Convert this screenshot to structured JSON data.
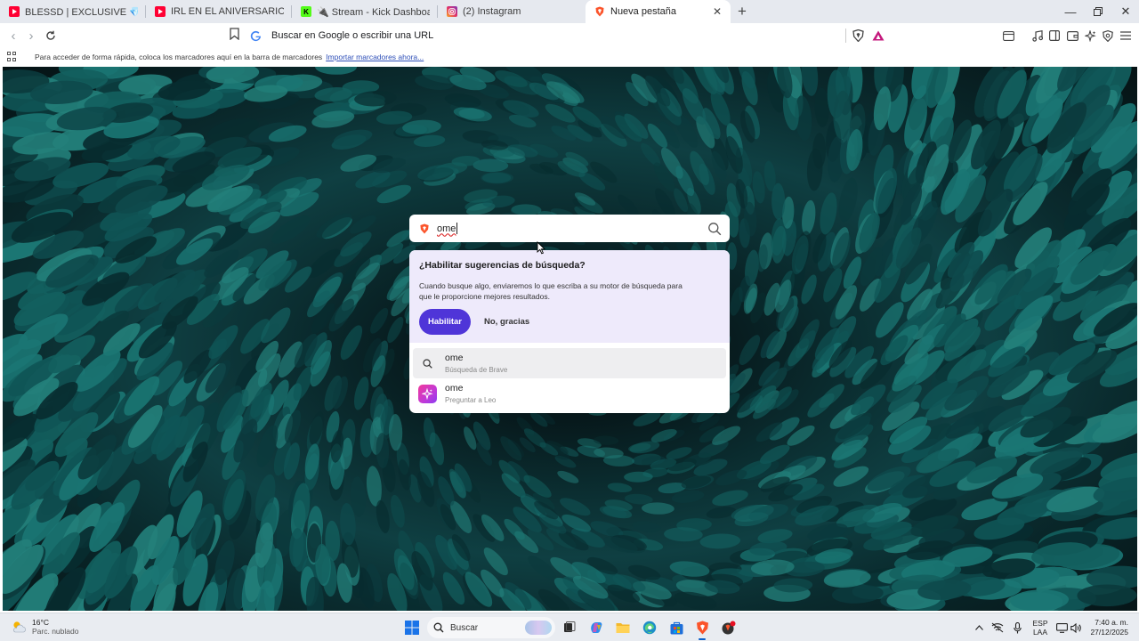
{
  "tabs": [
    {
      "title": "BLESSD | EXCLUSIVE 💎 - YouTube",
      "favicon": "youtube-icon",
      "color": "#ff0033",
      "active": false
    },
    {
      "title": "IRL EN EL ANIVERSARIO DE DULCINE",
      "favicon": "youtube-icon",
      "color": "#ff0033",
      "active": false
    },
    {
      "title": "🔌 Stream - Kick Dashboard",
      "favicon": "kick-icon",
      "color": "#1b1b1b",
      "active": false
    },
    {
      "title": "(2) Instagram",
      "favicon": "instagram-icon",
      "color": "#d6249f",
      "active": false
    },
    {
      "title": "Nueva pestaña",
      "favicon": "brave-icon",
      "color": "#fb542b",
      "active": true
    }
  ],
  "omnibox": {
    "placeholder": "Buscar en Google o escribir una URL"
  },
  "bookmarks": {
    "hint": "Para acceder de forma rápida, coloca los marcadores aquí en la barra de marcadores",
    "import_link": "Importar marcadores ahora..."
  },
  "search": {
    "query": "ome"
  },
  "suggestions_prompt": {
    "title": "¿Habilitar sugerencias de búsqueda?",
    "description": "Cuando busque algo, enviaremos lo que escriba a su motor de búsqueda para que le proporcione mejores resultados.",
    "enable_label": "Habilitar",
    "decline_label": "No, gracias"
  },
  "suggestions": [
    {
      "main": "ome",
      "sub": "Búsqueda de Brave",
      "icon": "search-icon"
    },
    {
      "main": "ome",
      "sub": "Preguntar a Leo",
      "icon": "leo-icon"
    }
  ],
  "taskbar": {
    "weather_temp": "16°C",
    "weather_desc": "Parc. nublado",
    "search_label": "Buscar",
    "lang_line1": "ESP",
    "lang_line2": "LAA",
    "time": "7:40 a. m.",
    "date": "27/12/2025"
  },
  "colors": {
    "accent": "#4f35d8",
    "brave": "#fb542b"
  }
}
